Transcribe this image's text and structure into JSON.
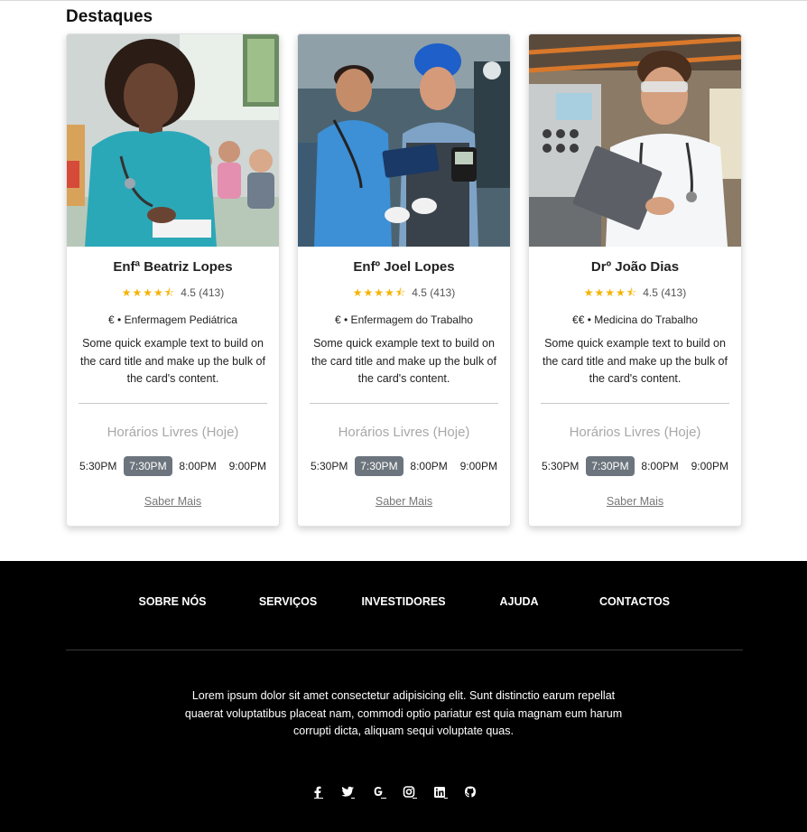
{
  "section": {
    "title": "Destaques"
  },
  "cards": [
    {
      "name": "Enfª Beatriz Lopes",
      "stars": "★★★★⯪",
      "rating": "4.5 (413)",
      "specialty": "€ • Enfermagem Pediátrica",
      "description": "Some quick example text to build on the card title and make up the bulk of the card's content.",
      "slots_title": "Horários Livres (Hoje)",
      "slots": [
        "5:30PM",
        "7:30PM",
        "8:00PM",
        "9:00PM"
      ],
      "selected_slot": "7:30PM",
      "more_label": "Saber Mais"
    },
    {
      "name": "Enfº Joel Lopes",
      "stars": "★★★★⯪",
      "rating": "4.5 (413)",
      "specialty": "€ • Enfermagem do Trabalho",
      "description": "Some quick example text to build on the card title and make up the bulk of the card's content.",
      "slots_title": "Horários Livres (Hoje)",
      "slots": [
        "5:30PM",
        "7:30PM",
        "8:00PM",
        "9:00PM"
      ],
      "selected_slot": "7:30PM",
      "more_label": "Saber Mais"
    },
    {
      "name": "Drº João Dias",
      "stars": "★★★★⯪",
      "rating": "4.5 (413)",
      "specialty": "€€ • Medicina do Trabalho",
      "description": "Some quick example text to build on the card title and make up the bulk of the card's content.",
      "slots_title": "Horários Livres (Hoje)",
      "slots": [
        "5:30PM",
        "7:30PM",
        "8:00PM",
        "9:00PM"
      ],
      "selected_slot": "7:30PM",
      "more_label": "Saber Mais"
    }
  ],
  "footer": {
    "nav": [
      "SOBRE NÓS",
      "SERVIÇOS",
      "INVESTIDORES",
      "AJUDA",
      "CONTACTOS"
    ],
    "text": "Lorem ipsum dolor sit amet consectetur adipisicing elit. Sunt distinctio earum repellat quaerat voluptatibus placeat nam, commodi optio pariatur est quia magnam eum harum corrupti dicta, aliquam sequi voluptate quas.",
    "social": [
      "facebook-icon",
      "twitter-icon",
      "google-icon",
      "instagram-icon",
      "linkedin-icon",
      "github-icon"
    ]
  },
  "colors": {
    "star": "#f5b301",
    "slot_active": "#6c757d",
    "footer_bg": "#000000"
  }
}
